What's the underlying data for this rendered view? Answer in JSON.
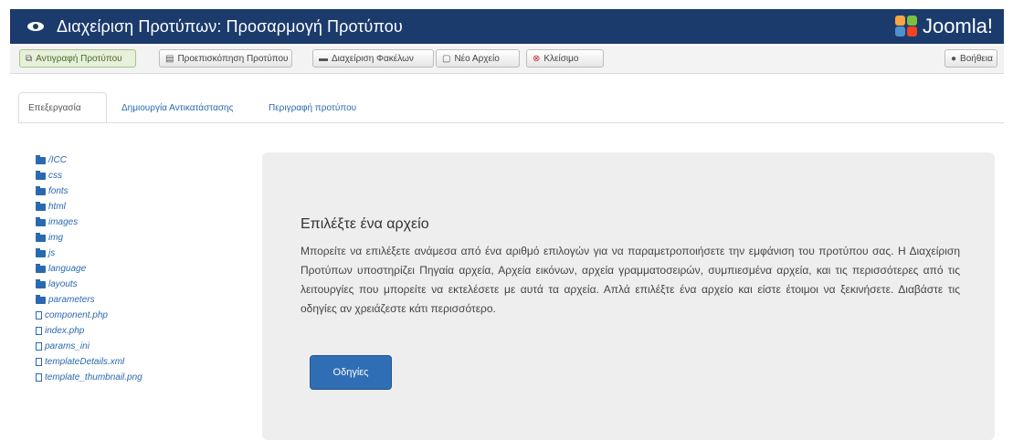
{
  "header": {
    "title": "Διαχείριση Προτύπων: Προσαρμογή Προτύπου",
    "brand": "Joomla!",
    "background": "#1b3b6d"
  },
  "toolbar": {
    "buttons": [
      {
        "label": "Αντιγραφή Προτύπου",
        "icon": "copy-icon"
      },
      {
        "label": "Προεπισκόπηση Προτύπου",
        "icon": "preview-icon"
      },
      {
        "label": "Διαχείριση Φακέλων",
        "icon": "folder-icon"
      },
      {
        "label": "Νέο Αρχείο",
        "icon": "new-file-icon"
      },
      {
        "label": "Κλείσιμο",
        "icon": "close-icon"
      }
    ],
    "help_label": "Βοήθεια"
  },
  "tabs": [
    {
      "label": "Επεξεργασία",
      "active": true
    },
    {
      "label": "Δημιουργία Αντικατάστασης",
      "active": false
    },
    {
      "label": "Περιγραφή προτύπου",
      "active": false
    }
  ],
  "tree": {
    "folders": [
      "/ICC",
      "css",
      "fonts",
      "html",
      "images",
      "img",
      "js",
      "language",
      "layouts",
      "parameters"
    ],
    "files": [
      "component.php",
      "index.php",
      "params_ini",
      "templateDetails.xml",
      "template_thumbnail.png"
    ]
  },
  "main": {
    "heading": "Επιλέξτε ένα αρχείο",
    "description": "Μπορείτε να επιλέξετε ανάμεσα από ένα αριθμό επιλογών για να παραμετροποιήσετε την εμφάνιση του προτύπου σας. Η Διαχείριση Προτύπων υποστηρίζει Πηγαία αρχεία, Αρχεία εικόνων, αρχεία γραμματοσειρών, συμπιεσμένα αρχεία, και τις περισσότερες από τις λειτουργίες που μπορείτε να εκτελέσετε με αυτά τα αρχεία. Απλά επιλέξτε ένα αρχείο και είστε έτοιμοι να ξεκινήσετε. Διαβάστε τις οδηγίες αν χρειάζεστε κάτι περισσότερο.",
    "button_label": "Οδηγίες",
    "button_color": "#2f6eb5"
  }
}
